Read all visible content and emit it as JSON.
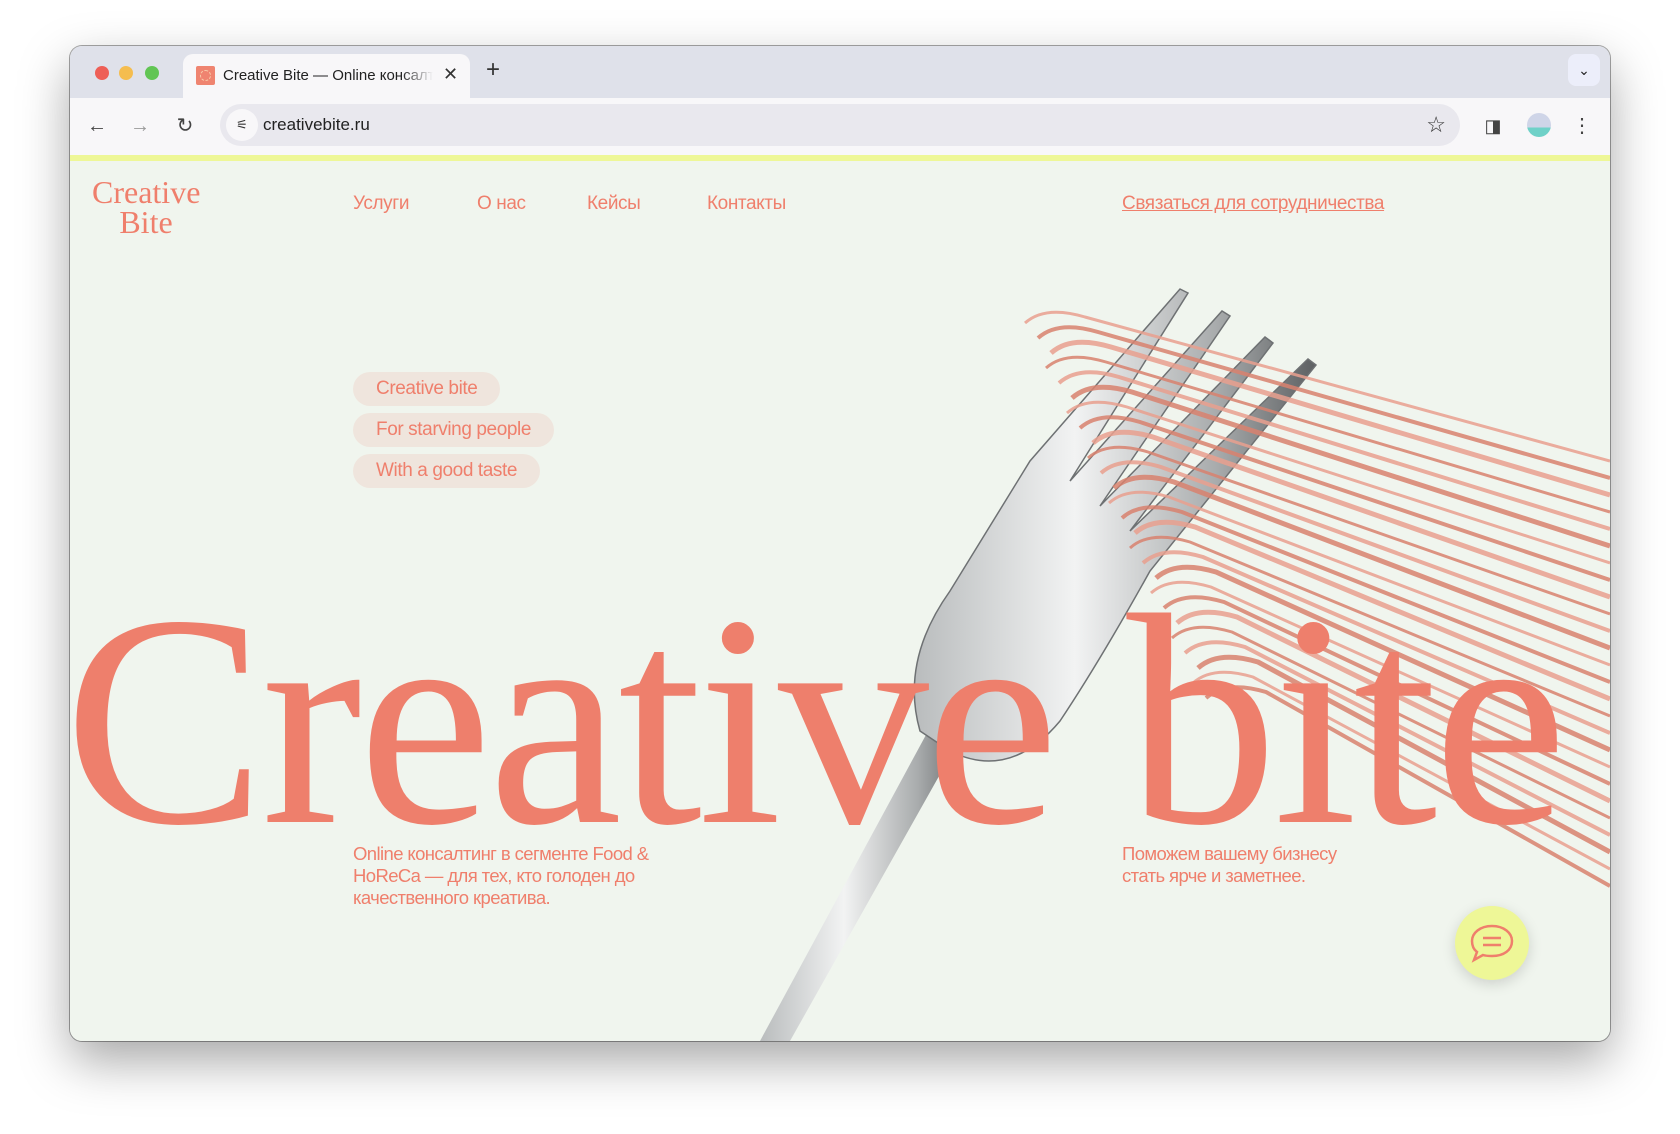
{
  "browser": {
    "tab_title": "Creative Bite — Online консалтинг",
    "new_tab_label": "+",
    "url": "creativebite.ru",
    "colors": {
      "close": "#ee5f57",
      "minimize": "#f5bd4f",
      "maximize": "#61c554"
    }
  },
  "site": {
    "logo_line1": "Creative",
    "logo_line2": "Bite",
    "nav": [
      "Услуги",
      "О нас",
      "Кейсы",
      "Контакты"
    ],
    "cta": "Связаться для сотрудничества",
    "pills": [
      "Creative bite",
      "For starving people",
      "With a good taste"
    ],
    "hero_title": "Creative bite",
    "description_left": "Online консалтинг в сегменте Food & HoReCa — для тех, кто голоден до качественного креатива.",
    "description_right": "Поможем вашему бизнесу стать ярче и заметнее.",
    "colors": {
      "accent": "#ef7f6c",
      "background": "#f0f5ee",
      "highlight": "#eef797",
      "pill": "#efe5dd"
    }
  }
}
